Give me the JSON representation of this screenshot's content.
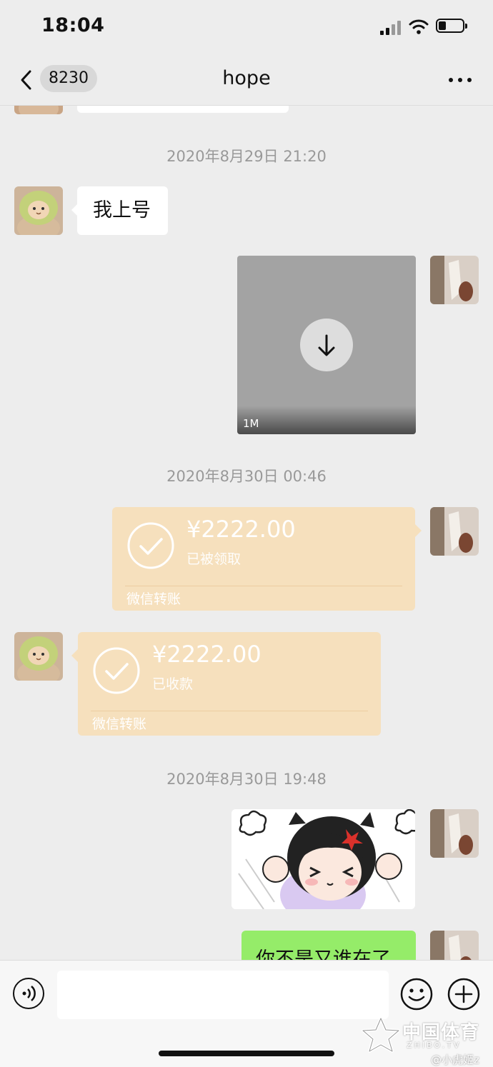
{
  "status_bar": {
    "time": "18:04"
  },
  "header": {
    "back_count": "8230",
    "title": "hope"
  },
  "messages": {
    "timestamp_1": "2020年8月29日 21:20",
    "text_1": "我上号",
    "video_size": "1M",
    "timestamp_2": "2020年8月30日 00:46",
    "transfer_sent": {
      "amount": "¥2222.00",
      "status": "已被领取",
      "source": "微信转账"
    },
    "transfer_received": {
      "amount": "¥2222.00",
      "status": "已收款",
      "source": "微信转账"
    },
    "timestamp_3": "2020年8月30日 19:48",
    "text_2": "你不是又谁在了"
  },
  "input": {
    "value": ""
  },
  "watermark": {
    "text": "中国体育",
    "sub": "ZHIBO.TV",
    "handle": "@小虎姬z"
  },
  "colors": {
    "background": "#ededed",
    "transfer": "#f6e0bd",
    "sent_bubble": "#95ec69"
  }
}
